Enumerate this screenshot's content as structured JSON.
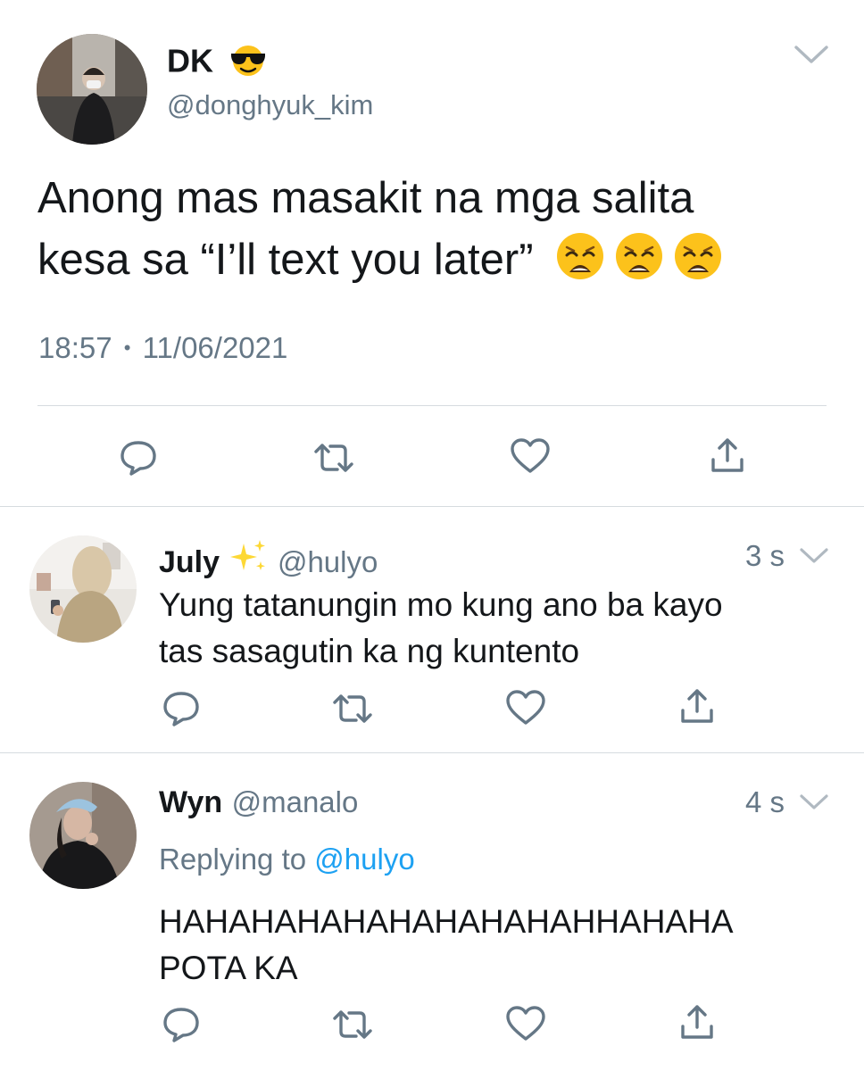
{
  "main_tweet": {
    "display_name": "DK",
    "name_emoji": "sunglasses-face",
    "handle": "@donghyuk_kim",
    "text_lines": [
      "Anong mas masakit na mga salita",
      "kesa sa “I’ll text you later”"
    ],
    "text_emojis": [
      "weary-face",
      "weary-face",
      "weary-face"
    ],
    "time": "18:57",
    "separator": "•",
    "date": "11/06/2021"
  },
  "replies": [
    {
      "display_name": "July",
      "name_emoji": "sparkles",
      "handle": "@hulyo",
      "time": "3 s",
      "text_lines": [
        "Yung tatanungin mo kung ano ba kayo",
        "tas sasagutin ka ng kuntento"
      ]
    },
    {
      "display_name": "Wyn",
      "handle": "@manalo",
      "time": "4 s",
      "replying_label": "Replying to",
      "replying_mention": "@hulyo",
      "text_lines": [
        "HAHAHAHAHAHAHAHAHAHHAHAHA",
        "POTA KA"
      ]
    }
  ],
  "actions": [
    "reply-icon",
    "retweet-icon",
    "like-icon",
    "share-icon"
  ],
  "colors": {
    "text": "#14171a",
    "secondary": "#657786",
    "link": "#1da1f2",
    "divider": "#d6dbdf",
    "icon": "#657786"
  }
}
